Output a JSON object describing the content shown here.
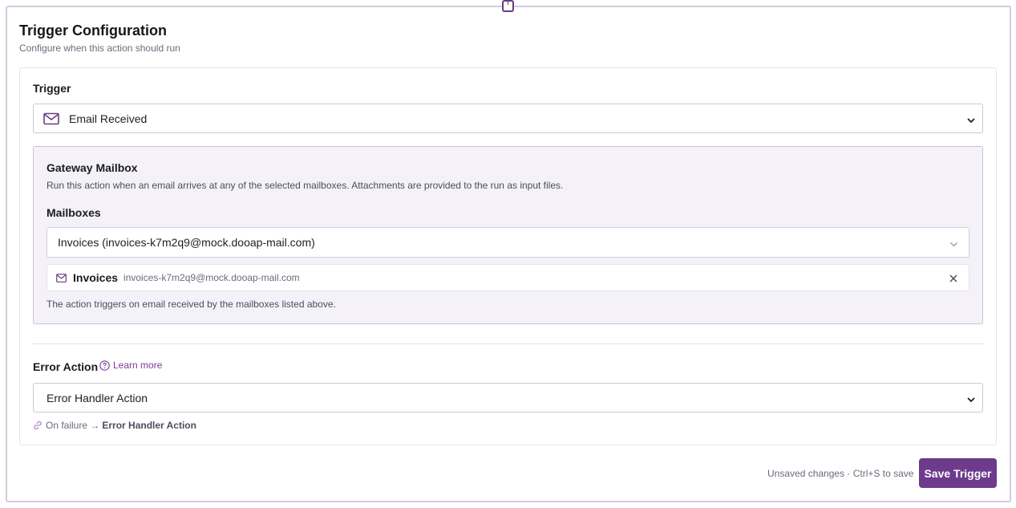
{
  "header": {
    "title": "Trigger Configuration",
    "subtitle": "Configure when this action should run"
  },
  "trigger": {
    "label": "Trigger",
    "selected": "Email Received",
    "icon": "mail-icon"
  },
  "gateway": {
    "title": "Gateway Mailbox",
    "description": "Run this action when an email arrives at any of the selected mailboxes. Attachments are provided to the run as input files.",
    "mailboxes_label": "Mailboxes",
    "selected_mailbox": "Invoices (invoices-k7m2q9@mock.dooap-mail.com)",
    "chips": [
      {
        "name": "Invoices",
        "email": "invoices-k7m2q9@mock.dooap-mail.com"
      }
    ],
    "note": "The action triggers on email received by the mailboxes listed above."
  },
  "error_action": {
    "label": "Error Action",
    "learn_more": "Learn more",
    "selected": "Error Handler Action",
    "failure_prefix": "On failure →",
    "failure_target": "Error Handler Action"
  },
  "footer": {
    "unsaved_text": "Unsaved changes · Ctrl+S to save",
    "save_label": "Save Trigger"
  },
  "colors": {
    "accent": "#6d3a8c",
    "link": "#7d3b9e",
    "panel_bg": "#f4f2f8",
    "panel_border": "#cdbfdc"
  }
}
